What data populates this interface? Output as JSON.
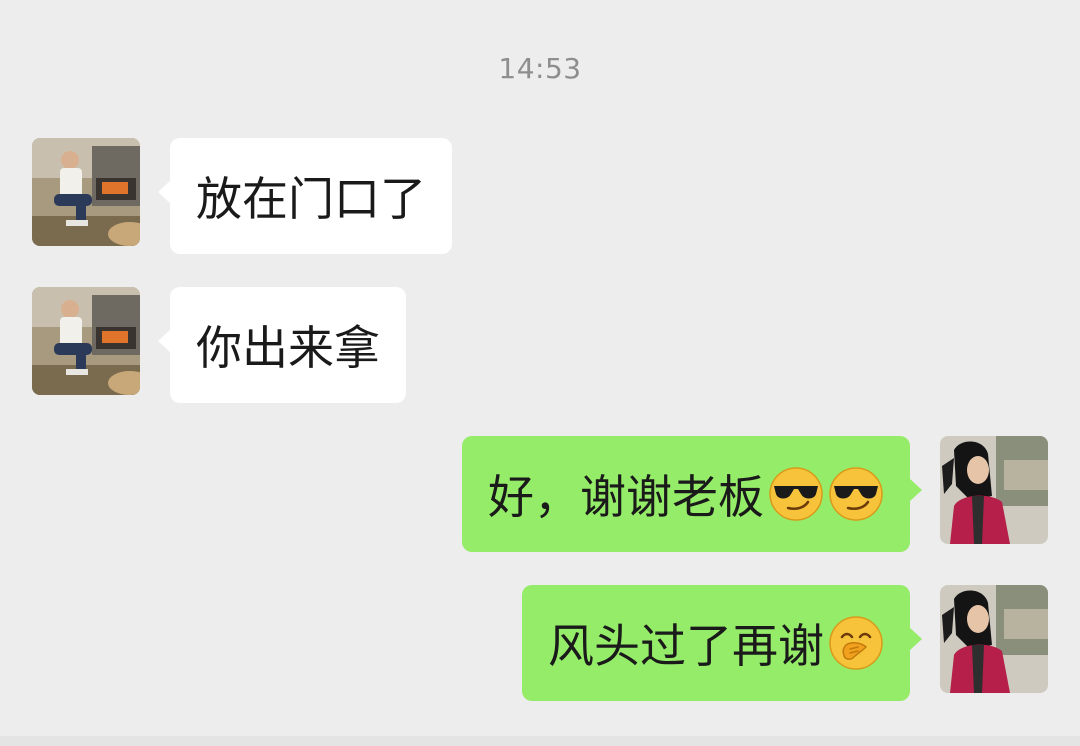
{
  "chat": {
    "timestamp": "14:53",
    "messages": [
      {
        "side": "incoming",
        "sender": "boss",
        "text": "放在门口了",
        "emojis": []
      },
      {
        "side": "incoming",
        "sender": "boss",
        "text": "你出来拿",
        "emojis": []
      },
      {
        "side": "outgoing",
        "sender": "me",
        "text": "好，谢谢老板",
        "emojis": [
          "sunglasses-smirk-icon",
          "sunglasses-smirk-icon"
        ]
      },
      {
        "side": "outgoing",
        "sender": "me",
        "text": "风头过了再谢",
        "emojis": [
          "hand-over-mouth-icon"
        ]
      }
    ]
  },
  "colors": {
    "background": "#ededed",
    "incoming_bubble": "#ffffff",
    "outgoing_bubble": "#95ec69",
    "timestamp_text": "#8e8e8e",
    "message_text": "#1a1a1a"
  }
}
